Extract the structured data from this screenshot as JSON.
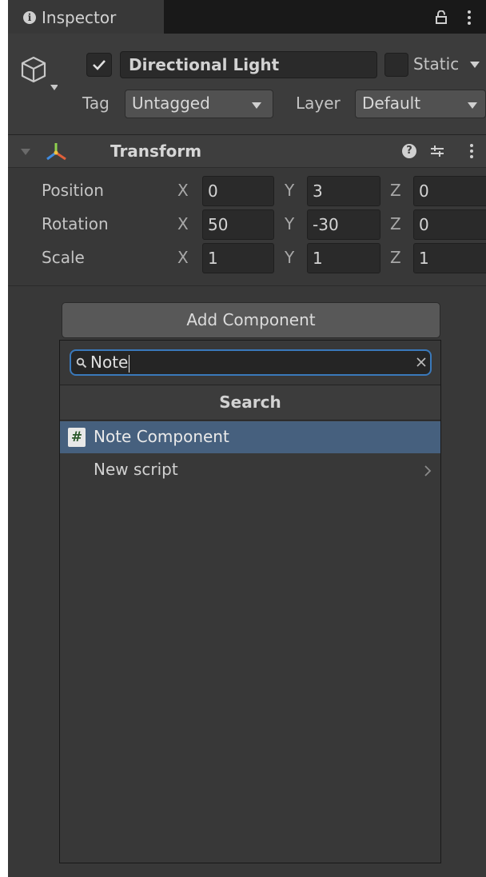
{
  "tab": {
    "title": "Inspector"
  },
  "gameobject": {
    "name": "Directional Light",
    "active": true,
    "static_label": "Static",
    "tag_label": "Tag",
    "tag_value": "Untagged",
    "layer_label": "Layer",
    "layer_value": "Default"
  },
  "transform": {
    "title": "Transform",
    "rows": [
      {
        "label": "Position",
        "x": "0",
        "y": "3",
        "z": "0"
      },
      {
        "label": "Rotation",
        "x": "50",
        "y": "-30",
        "z": "0"
      },
      {
        "label": "Scale",
        "x": "1",
        "y": "1",
        "z": "1"
      }
    ],
    "axis_x": "X",
    "axis_y": "Y",
    "axis_z": "Z"
  },
  "add_component": {
    "button_label": "Add Component",
    "search_value": "Note",
    "section_header": "Search",
    "results": [
      {
        "label": "Note Component",
        "icon": "#"
      },
      {
        "label": "New script"
      }
    ]
  },
  "colors": {
    "selection": "#46607e",
    "search_focus": "#3a79bb",
    "panel_bg": "#383838"
  }
}
